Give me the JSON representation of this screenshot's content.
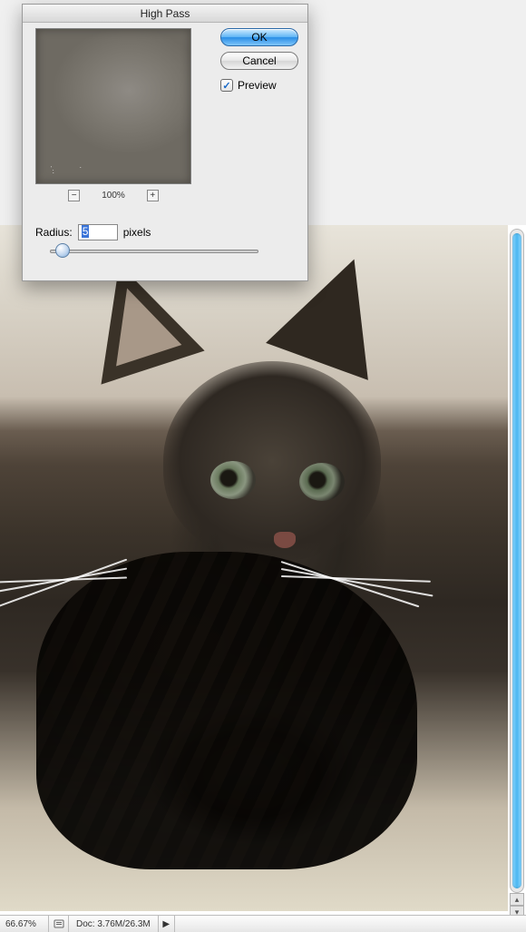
{
  "dialog": {
    "title": "High Pass",
    "ok_label": "OK",
    "cancel_label": "Cancel",
    "preview_label": "Preview",
    "preview_checked": true,
    "zoom_percent": "100%",
    "zoom_out_glyph": "−",
    "zoom_in_glyph": "+",
    "radius_label": "Radius:",
    "radius_value": "5",
    "radius_unit": "pixels"
  },
  "status": {
    "zoom": "66.67%",
    "doc": "Doc: 3.76M/26.3M",
    "play_glyph": "▶"
  },
  "scroll": {
    "up_glyph": "▴",
    "down_glyph": "▾"
  }
}
